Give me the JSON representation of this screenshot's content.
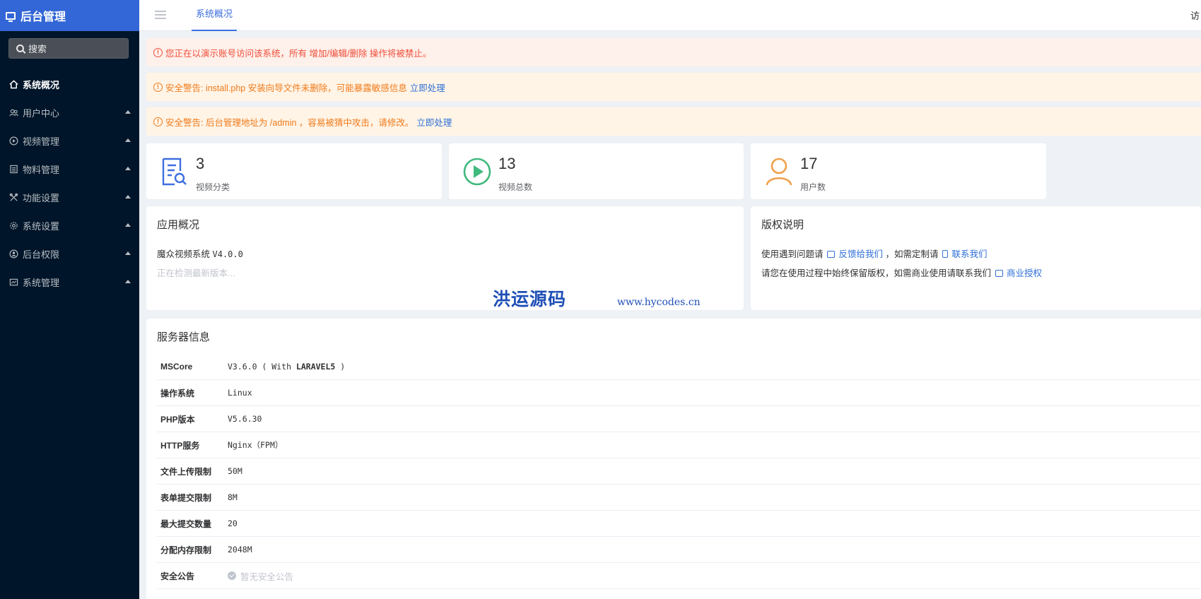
{
  "sidebar": {
    "brand": "后台管理",
    "search_placeholder": "搜索",
    "items": [
      {
        "label": "系统概况",
        "icon": "home-icon",
        "active": true
      },
      {
        "label": "用户中心",
        "icon": "users-icon"
      },
      {
        "label": "视频管理",
        "icon": "play-circle-icon"
      },
      {
        "label": "物料管理",
        "icon": "list-icon"
      },
      {
        "label": "功能设置",
        "icon": "tools-icon"
      },
      {
        "label": "系统设置",
        "icon": "gear-icon"
      },
      {
        "label": "后台权限",
        "icon": "user-shield-icon"
      },
      {
        "label": "系统管理",
        "icon": "dashboard-icon"
      }
    ]
  },
  "topbar": {
    "active_tab": "系统概况",
    "right_text": "访"
  },
  "alerts": {
    "demo": "您正在以演示账号访问该系统，所有 增加/编辑/删除 操作将被禁止。",
    "install_warning": "安全警告: install.php 安装向导文件未删除，可能暴露敏感信息",
    "install_action": "立即处理",
    "admin_warning": "安全警告: 后台管理地址为 /admin ，容易被猜中攻击，请修改。",
    "admin_action": "立即处理"
  },
  "stats": [
    {
      "value": "3",
      "label": "视频分类",
      "icon": "document-search-icon",
      "color": "#3d6fe0"
    },
    {
      "value": "13",
      "label": "视频总数",
      "icon": "play-circle-icon",
      "color": "#3fb97d"
    },
    {
      "value": "17",
      "label": "用户数",
      "icon": "user-icon",
      "color": "#f0a04b"
    }
  ],
  "app_overview": {
    "title": "应用概况",
    "name": "魔众视频系统",
    "version": "V4.0.0",
    "checking": "正在检测最新版本..."
  },
  "copyright": {
    "title": "版权说明",
    "line1_prefix": "使用遇到问题请",
    "feedback": "反馈给我们",
    "line1_mid": "，如需定制请",
    "contact": "联系我们",
    "line2_prefix": "请您在使用过程中始终保留版权，如需商业使用请联系我们",
    "license": "商业授权"
  },
  "watermark": {
    "text": "洪运源码",
    "url": "www.hycodes.cn"
  },
  "server": {
    "title": "服务器信息",
    "rows": [
      {
        "key": "MSCore",
        "value_pre": "V3.6.0 ( With ",
        "value_bold": "LARAVEL5",
        "value_post": " )"
      },
      {
        "key": "操作系统",
        "value": "Linux"
      },
      {
        "key": "PHP版本",
        "value": "V5.6.30"
      },
      {
        "key": "HTTP服务",
        "value": "Nginx（FPM）"
      },
      {
        "key": "文件上传限制",
        "value": "50M"
      },
      {
        "key": "表单提交限制",
        "value": "8M"
      },
      {
        "key": "最大提交数量",
        "value": "20"
      },
      {
        "key": "分配内存限制",
        "value": "2048M"
      },
      {
        "key": "安全公告",
        "value": "暂无安全公告"
      }
    ]
  }
}
